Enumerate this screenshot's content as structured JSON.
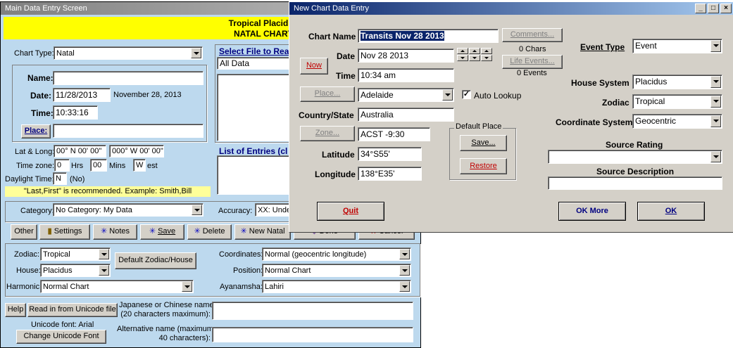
{
  "main_window": {
    "title": "Main Data Entry Screen",
    "header_line1": "Tropical  Placidus",
    "header_line2": "NATAL CHART",
    "chart_type_label": "Chart Type:",
    "chart_type_value": "Natal",
    "name_label": "Name:",
    "name_value": "",
    "date_label": "Date:",
    "date_value": "11/28/2013",
    "date_long": "November 28, 2013",
    "time_label": "Time:",
    "time_value": "10:33:16",
    "place_button": "Place:",
    "place_value": "",
    "latlong_label": "Lat & Long:",
    "lat_value": "00° N 00' 00\"",
    "long_value": "000° W 00' 00\"",
    "timezone_label": "Time zone:",
    "tz_hours": "0",
    "tz_hrs_label": "Hrs",
    "tz_mins": "00",
    "tz_mins_label": "Mins",
    "tz_dir": "W",
    "tz_dir_label": "est",
    "dst_label": "Daylight Time:",
    "dst_value": "N",
    "dst_text": "(No)",
    "hint": "\"Last,First\" is recommended.  Example: Smith,Bill",
    "select_file_label": "Select File to Rea",
    "file_list": [
      "All Data"
    ],
    "entries_label": "List of Entries  (cl",
    "category_label": "Category:",
    "category_value": "No Category: My Data",
    "accuracy_label": "Accuracy:",
    "accuracy_value": "XX:  Unde",
    "buttons": {
      "other": "Other",
      "settings": "Settings",
      "notes": "Notes",
      "save": "Save",
      "delete": "Delete",
      "new_natal": "New Natal",
      "done": "Done",
      "cancel": "Cancel"
    },
    "zodiac_label": "Zodiac:",
    "zodiac_value": "Tropical",
    "house_label": "House:",
    "house_value": "Placidus",
    "default_zh_button": "Default Zodiac/House",
    "coordinates_label": "Coordinates:",
    "coordinates_value": "Normal  (geocentric longitude)",
    "position_label": "Position:",
    "position_value": "Normal Chart",
    "harmonic_label": "Harmonic:",
    "harmonic_value": "Normal Chart",
    "ayanamsha_label": "Ayanamsha:",
    "ayanamsha_value": "Lahiri",
    "help_button": "Help",
    "unicode_button": "Read in from Unicode file",
    "japanese_label_1": "Japanese or Chinese name",
    "japanese_label_2": "(20 characters maximum):",
    "unicode_font_label": "Unicode font: Arial",
    "change_font_button": "Change Unicode Font",
    "alt_name_label_1": "Alternative name (maximum",
    "alt_name_label_2": "40 characters):"
  },
  "dialog": {
    "title": "New Chart Data Entry",
    "chart_name_label": "Chart Name",
    "chart_name_value": "Transits Nov 28 2013",
    "comments_button": "Comments...",
    "chars_text": "0 Chars",
    "now_button": "Now",
    "date_label": "Date",
    "date_value": "Nov 28 2013",
    "time_label": "Time",
    "time_value": "10:34 am",
    "life_events_button": "Life Events...",
    "events_text": "0 Events",
    "place_button": "Place...",
    "place_value": "Adelaide",
    "auto_lookup_label": "Auto Lookup",
    "country_label": "Country/State",
    "country_value": "Australia",
    "zone_button": "Zone...",
    "zone_value": "ACST -9:30",
    "default_place_label": "Default Place",
    "save_button": "Save...",
    "restore_button": "Restore",
    "latitude_label": "Latitude",
    "latitude_value": "34°S55'",
    "longitude_label": "Longitude",
    "longitude_value": "138°E35'",
    "event_type_label": "Event Type",
    "event_type_value": "Event",
    "house_system_label": "House System",
    "house_system_value": "Placidus",
    "zodiac_label": "Zodiac",
    "zodiac_value": "Tropical",
    "coord_system_label": "Coordinate System",
    "coord_system_value": "Geocentric",
    "source_rating_label": "Source Rating",
    "source_rating_value": "",
    "source_desc_label": "Source Description",
    "source_desc_value": "",
    "quit_button": "Quit",
    "ok_more_button": "OK More",
    "ok_button": "OK"
  },
  "colors": {
    "main_bg": "#bdd9ee",
    "header_yellow": "#ffff00",
    "hint_yellow": "#ffff99",
    "dialog_bg": "#d4d0c8",
    "quit_red": "#c00000"
  }
}
